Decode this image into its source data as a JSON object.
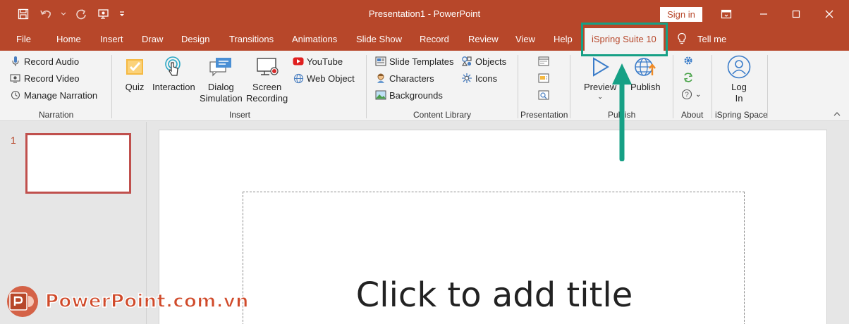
{
  "window": {
    "title": "Presentation1  -  PowerPoint",
    "sign_in": "Sign in"
  },
  "tabs": {
    "file": "File",
    "home": "Home",
    "insert": "Insert",
    "draw": "Draw",
    "design": "Design",
    "transitions": "Transitions",
    "animations": "Animations",
    "slide_show": "Slide Show",
    "record": "Record",
    "review": "Review",
    "view": "View",
    "help": "Help",
    "ispring": "iSpring Suite 10",
    "tell_me": "Tell me"
  },
  "ribbon": {
    "narration": {
      "record_audio": "Record Audio",
      "record_video": "Record Video",
      "manage_narration": "Manage Narration",
      "label": "Narration"
    },
    "insert": {
      "quiz": "Quiz",
      "interaction": "Interaction",
      "dialog_1": "Dialog",
      "dialog_2": "Simulation",
      "screen_1": "Screen",
      "screen_2": "Recording",
      "youtube": "YouTube",
      "web_object": "Web Object",
      "label": "Insert"
    },
    "content_library": {
      "slide_templates": "Slide Templates",
      "characters": "Characters",
      "backgrounds": "Backgrounds",
      "objects": "Objects",
      "icons": "Icons",
      "label": "Content Library"
    },
    "presentation": {
      "label": "Presentation"
    },
    "publish": {
      "preview": "Preview",
      "publish": "Publish",
      "label": "Publish"
    },
    "about": {
      "label": "About"
    },
    "ispring_space": {
      "log_1": "Log",
      "log_2": "In",
      "label": "iSpring Space"
    }
  },
  "slides": {
    "number": "1",
    "placeholder": "Click to add title"
  },
  "watermark": "PowerPoint.com.vn",
  "colors": {
    "accent": "#b7472a",
    "highlight": "#16a085"
  }
}
